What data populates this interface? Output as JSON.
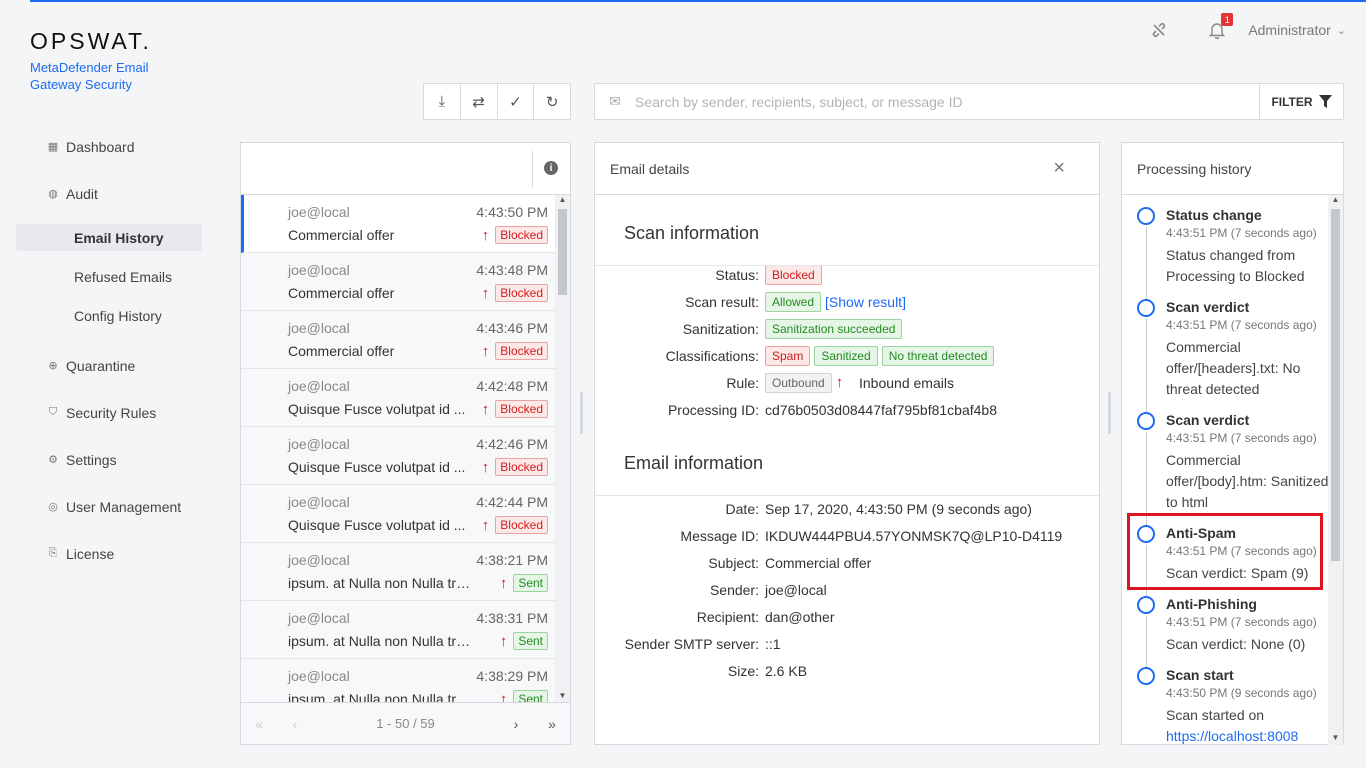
{
  "brand": {
    "logo": "OPSWAT.",
    "product": "MetaDefender Email Gateway Security"
  },
  "header": {
    "notifications_count": "1",
    "user": "Administrator"
  },
  "sidebar": {
    "items": [
      {
        "label": "Dashboard",
        "icon": "dashboard-icon"
      },
      {
        "label": "Audit",
        "icon": "audit-icon"
      },
      {
        "label": "Quarantine",
        "icon": "quarantine-icon"
      },
      {
        "label": "Security Rules",
        "icon": "shield-icon"
      },
      {
        "label": "Settings",
        "icon": "gear-icon"
      },
      {
        "label": "User Management",
        "icon": "user-icon"
      },
      {
        "label": "License",
        "icon": "license-icon"
      }
    ],
    "audit_sub": [
      "Email History",
      "Refused Emails",
      "Config History"
    ]
  },
  "search": {
    "placeholder": "Search by sender, recipients, subject, or message ID",
    "value": "",
    "filter_label": "FILTER"
  },
  "email_list": {
    "rows": [
      {
        "sender": "joe@local",
        "time": "4:43:50 PM",
        "subject": "Commercial offer",
        "status": "Blocked"
      },
      {
        "sender": "joe@local",
        "time": "4:43:48 PM",
        "subject": "Commercial offer",
        "status": "Blocked"
      },
      {
        "sender": "joe@local",
        "time": "4:43:46 PM",
        "subject": "Commercial offer",
        "status": "Blocked"
      },
      {
        "sender": "joe@local",
        "time": "4:42:48 PM",
        "subject": "Quisque Fusce volutpat id ...",
        "status": "Blocked"
      },
      {
        "sender": "joe@local",
        "time": "4:42:46 PM",
        "subject": "Quisque Fusce volutpat id ...",
        "status": "Blocked"
      },
      {
        "sender": "joe@local",
        "time": "4:42:44 PM",
        "subject": "Quisque Fusce volutpat id ...",
        "status": "Blocked"
      },
      {
        "sender": "joe@local",
        "time": "4:38:21 PM",
        "subject": "ipsum. at Nulla non Nulla trist...",
        "status": "Sent"
      },
      {
        "sender": "joe@local",
        "time": "4:38:31 PM",
        "subject": "ipsum. at Nulla non Nulla trist...",
        "status": "Sent"
      },
      {
        "sender": "joe@local",
        "time": "4:38:29 PM",
        "subject": "ipsum. at Nulla non Nulla trist...",
        "status": "Sent"
      }
    ],
    "pagination": "1 - 50 / 59"
  },
  "details": {
    "title": "Email details",
    "scan_section": "Scan information",
    "status_label": "Status:",
    "status": "Blocked",
    "scan_result_label": "Scan result:",
    "scan_result": "Allowed",
    "show_result": "[Show result]",
    "sanitization_label": "Sanitization:",
    "sanitization": "Sanitization succeeded",
    "classifications_label": "Classifications:",
    "classifications": [
      "Spam",
      "Sanitized",
      "No threat detected"
    ],
    "rule_label": "Rule:",
    "rule_direction": "Outbound",
    "rule_name": "Inbound emails",
    "processing_id_label": "Processing ID:",
    "processing_id": "cd76b0503d08447faf795bf81cbaf4b8",
    "email_section": "Email information",
    "date_label": "Date:",
    "date": "Sep 17, 2020, 4:43:50 PM (9 seconds ago)",
    "message_id_label": "Message ID:",
    "message_id": "IKDUW444PBU4.57YONMSK7Q@LP10-D4119",
    "subject_label": "Subject:",
    "subject": "Commercial offer",
    "sender_label": "Sender:",
    "sender": "joe@local",
    "recipient_label": "Recipient:",
    "recipient": "dan@other",
    "smtp_label": "Sender SMTP server:",
    "smtp": "::1",
    "size_label": "Size:",
    "size": "2.6 KB"
  },
  "history": {
    "title": "Processing history",
    "items": [
      {
        "title": "Status change",
        "time": "4:43:51 PM (7 seconds ago)",
        "desc": "Status changed from Processing to Blocked"
      },
      {
        "title": "Scan verdict",
        "time": "4:43:51 PM (7 seconds ago)",
        "desc": "Commercial offer/[headers].txt: No threat detected"
      },
      {
        "title": "Scan verdict",
        "time": "4:43:51 PM (7 seconds ago)",
        "desc": "Commercial offer/[body].htm: Sanitized to html"
      },
      {
        "title": "Anti-Spam",
        "time": "4:43:51 PM (7 seconds ago)",
        "desc": "Scan verdict: Spam (9)"
      },
      {
        "title": "Anti-Phishing",
        "time": "4:43:51 PM (7 seconds ago)",
        "desc": "Scan verdict: None (0)"
      },
      {
        "title": "Scan start",
        "time": "4:43:50 PM (9 seconds ago)",
        "desc": "Scan started on",
        "link": "https://localhost:8008"
      }
    ]
  }
}
